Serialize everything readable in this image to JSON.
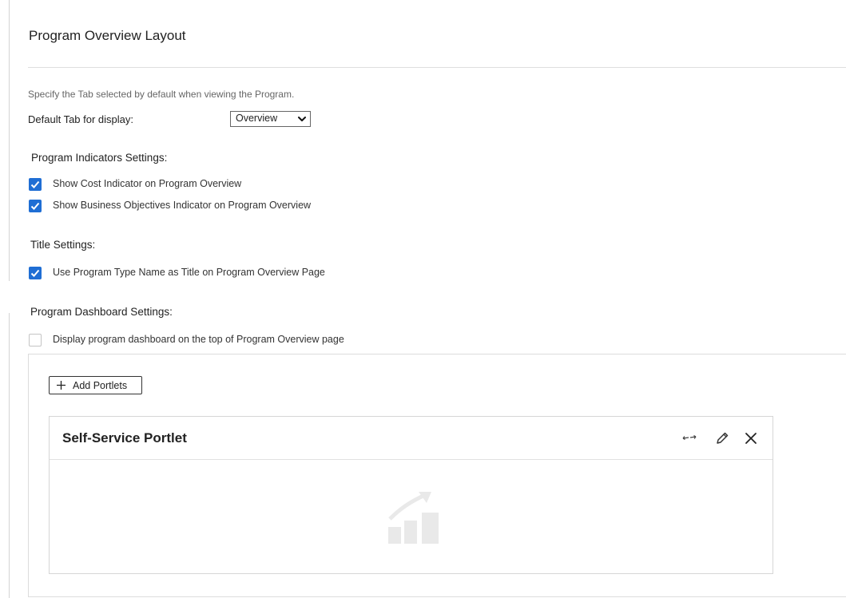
{
  "panel": {
    "title": "Program Overview Layout"
  },
  "default_tab": {
    "hint": "Specify the Tab selected by default when viewing the Program.",
    "label": "Default Tab for display:",
    "selected": "Overview"
  },
  "indicators": {
    "heading": "Program Indicators Settings:",
    "items": [
      {
        "label": "Show Cost Indicator on Program Overview",
        "checked": true
      },
      {
        "label": "Show Business Objectives Indicator on Program Overview",
        "checked": true
      }
    ]
  },
  "title_settings": {
    "heading": "Title Settings:",
    "items": [
      {
        "label": "Use Program Type Name as Title on Program Overview Page",
        "checked": true
      }
    ]
  },
  "dashboard": {
    "heading": "Program Dashboard Settings:",
    "items": [
      {
        "label": "Display program dashboard on the top of Program Overview page",
        "checked": false
      }
    ],
    "add_button_label": "Add Portlets",
    "portlet": {
      "title": "Self-Service Portlet",
      "icons": [
        "swap-icon",
        "pencil-icon",
        "close-icon"
      ],
      "placeholder_icon": "chart-growth-icon"
    }
  },
  "colors": {
    "checkbox_checked": "#1f6ed4",
    "placeholder_icon": "#e9e9e9"
  }
}
